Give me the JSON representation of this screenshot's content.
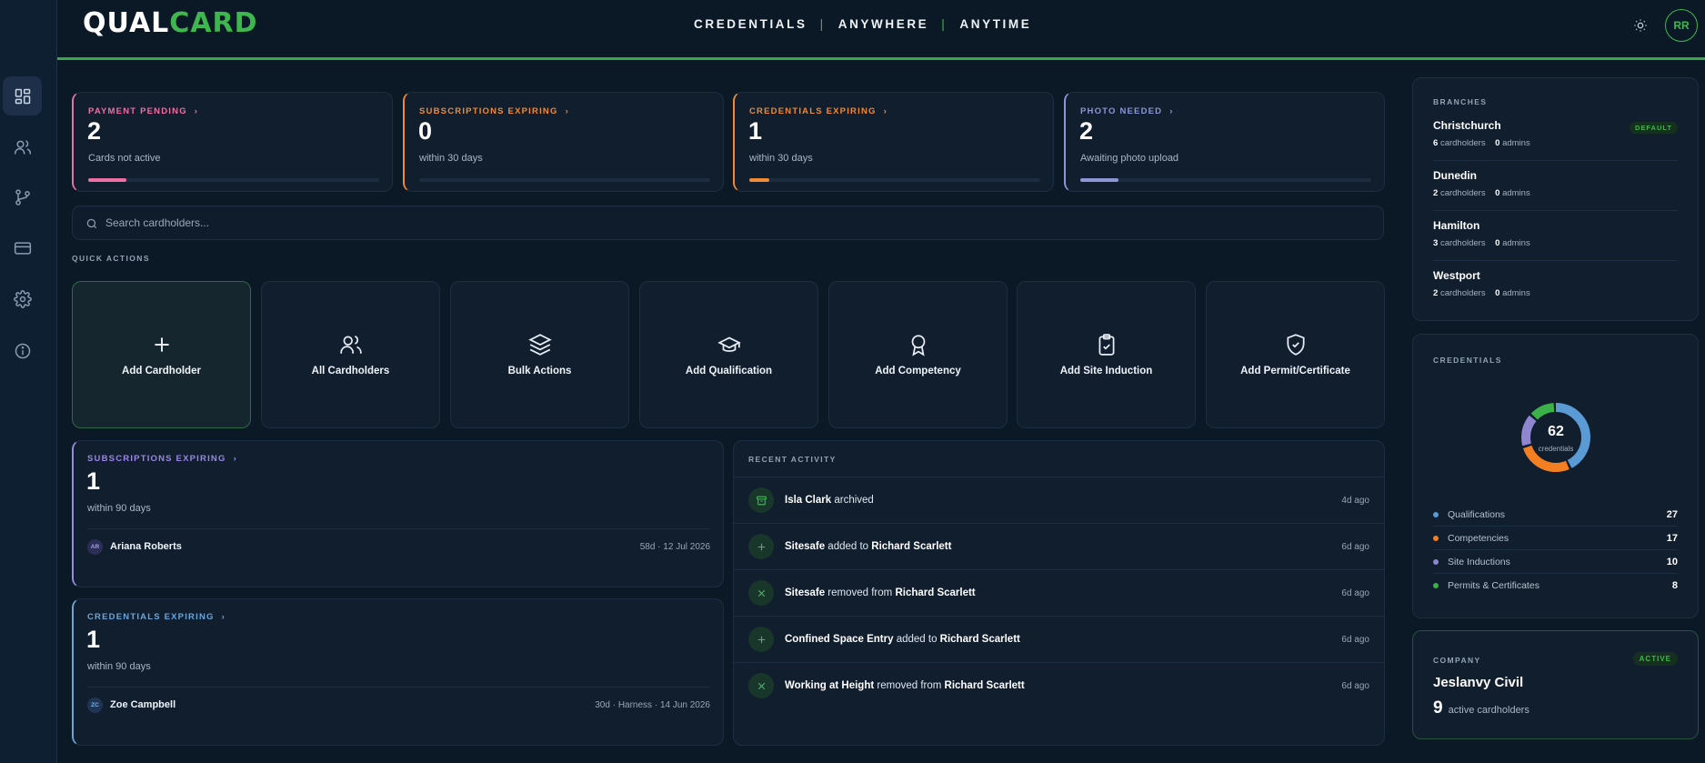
{
  "header": {
    "logo_q": "Q",
    "logo_ual": "UAL",
    "logo_card": "CARD",
    "tagline": [
      "CREDENTIALS",
      "ANYWHERE",
      "ANYTIME"
    ],
    "separator": "|",
    "user_initials": "RR"
  },
  "sidebar": {
    "items": [
      {
        "icon": "dashboard-icon",
        "active": true
      },
      {
        "icon": "users-icon",
        "active": false
      },
      {
        "icon": "branches-icon",
        "active": false
      },
      {
        "icon": "card-icon",
        "active": false
      },
      {
        "icon": "gear-icon",
        "active": false
      },
      {
        "icon": "info-icon",
        "active": false
      }
    ]
  },
  "stats": [
    {
      "label": "PAYMENT PENDING",
      "value": "2",
      "sub": "Cards not active",
      "color": "#ee6fa4",
      "progress": 0.13
    },
    {
      "label": "SUBSCRIPTIONS EXPIRING",
      "value": "0",
      "sub": "within 30 days",
      "color": "#f08a34",
      "progress": 0
    },
    {
      "label": "CREDENTIALS EXPIRING",
      "value": "1",
      "sub": "within 30 days",
      "color": "#f08a34",
      "progress": 0.07
    },
    {
      "label": "PHOTO NEEDED",
      "value": "2",
      "sub": "Awaiting photo upload",
      "color": "#8d96d6",
      "progress": 0.13
    }
  ],
  "search": {
    "placeholder": "Search cardholders..."
  },
  "quick_actions": {
    "title": "QUICK ACTIONS",
    "items": [
      {
        "label": "Add Cardholder",
        "icon": "plus-icon"
      },
      {
        "label": "All Cardholders",
        "icon": "users-icon"
      },
      {
        "label": "Bulk Actions",
        "icon": "layers-icon"
      },
      {
        "label": "Add Qualification",
        "icon": "graduation-cap-icon"
      },
      {
        "label": "Add Competency",
        "icon": "award-icon"
      },
      {
        "label": "Add Site Induction",
        "icon": "clipboard-check-icon"
      },
      {
        "label": "Add Permit/Certificate",
        "icon": "shield-check-icon"
      }
    ]
  },
  "subscriptions_expiring": {
    "label": "SUBSCRIPTIONS EXPIRING",
    "value": "1",
    "sub": "within 90 days",
    "color": "#9a86e8",
    "row": {
      "initials": "AR",
      "name": "Ariana Roberts",
      "meta": "58d · 12 Jul 2026"
    }
  },
  "credentials_expiring": {
    "label": "CREDENTIALS EXPIRING",
    "value": "1",
    "sub": "within 90 days",
    "color": "#6aa6dc",
    "row": {
      "initials": "ZC",
      "name": "Zoe Campbell",
      "meta": "30d · Harness · 14 Jun 2026"
    }
  },
  "recent_activity": {
    "title": "RECENT ACTIVITY",
    "items": [
      {
        "icon": "archive-icon",
        "subject": "Isla Clark",
        "action": " archived",
        "target": "",
        "time": "4d ago"
      },
      {
        "icon": "plus-icon",
        "subject": "Sitesafe",
        "action": " added to ",
        "target": "Richard Scarlett",
        "time": "6d ago"
      },
      {
        "icon": "x-icon",
        "subject": "Sitesafe",
        "action": " removed from ",
        "target": "Richard Scarlett",
        "time": "6d ago"
      },
      {
        "icon": "plus-icon",
        "subject": "Confined Space Entry",
        "action": " added to ",
        "target": "Richard Scarlett",
        "time": "6d ago"
      },
      {
        "icon": "x-icon",
        "subject": "Working at Height",
        "action": " removed from ",
        "target": "Richard Scarlett",
        "time": "6d ago"
      }
    ]
  },
  "branches": {
    "title": "BRANCHES",
    "default_badge": "DEFAULT",
    "items": [
      {
        "name": "Christchurch",
        "cardholders": "6",
        "admins": "0",
        "is_default": true
      },
      {
        "name": "Dunedin",
        "cardholders": "2",
        "admins": "0",
        "is_default": false
      },
      {
        "name": "Hamilton",
        "cardholders": "3",
        "admins": "0",
        "is_default": false
      },
      {
        "name": "Westport",
        "cardholders": "2",
        "admins": "0",
        "is_default": false
      }
    ],
    "cardholders_word": "cardholders",
    "admins_word": "admins"
  },
  "credentials": {
    "title": "CREDENTIALS",
    "total": "62",
    "total_label": "credentials",
    "items": [
      {
        "name": "Qualifications",
        "value": 27,
        "color": "#5b9bd5"
      },
      {
        "name": "Competencies",
        "value": 17,
        "color": "#f47f23"
      },
      {
        "name": "Site Inductions",
        "value": 10,
        "color": "#8e86cf"
      },
      {
        "name": "Permits & Certificates",
        "value": 8,
        "color": "#3cb14a"
      }
    ]
  },
  "company": {
    "title": "COMPANY",
    "status": "ACTIVE",
    "name": "Jeslanvy Civil",
    "count": "9",
    "count_label": "active cardholders"
  }
}
